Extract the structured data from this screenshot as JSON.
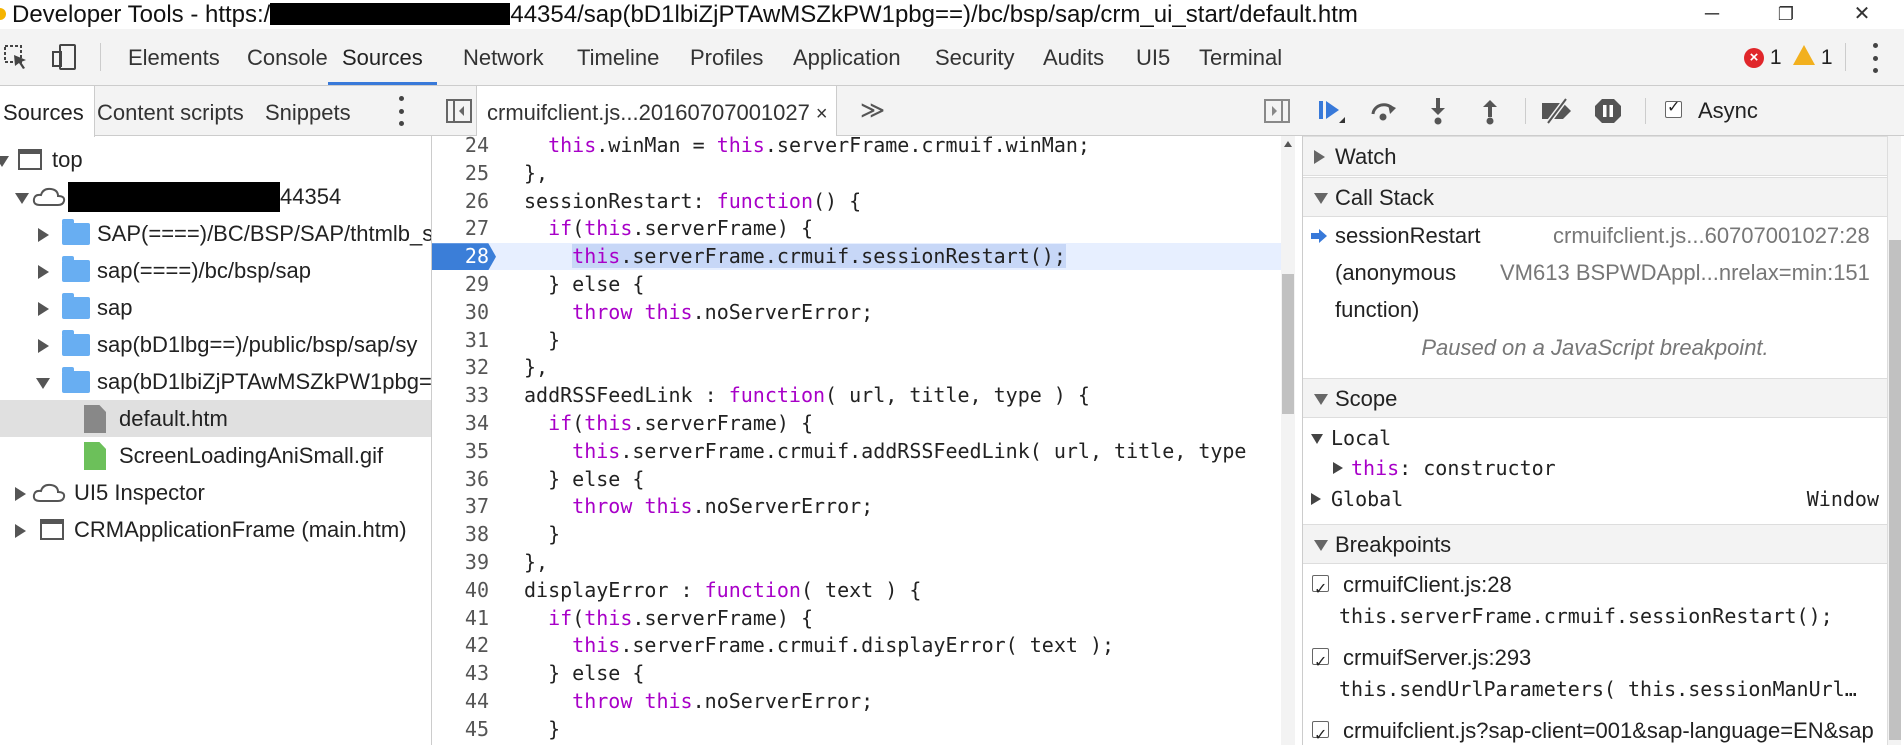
{
  "window": {
    "title_prefix": "Developer Tools - https:/",
    "title_suffix": "44354/sap(bD1lbiZjPTAwMSZkPW1pbg==)/bc/bsp/sap/crm_ui_start/default.htm",
    "minimize": "─",
    "maximize": "❐",
    "close": "✕"
  },
  "main_tabs": [
    "Elements",
    "Console",
    "Sources",
    "Network",
    "Timeline",
    "Profiles",
    "Application",
    "Security",
    "Audits",
    "UI5",
    "Terminal"
  ],
  "active_main_tab": "Sources",
  "counters": {
    "errors": "1",
    "warnings": "1"
  },
  "navigator": {
    "tabs": [
      "Sources",
      "Content scripts",
      "Snippets"
    ],
    "tree": [
      {
        "label": "top"
      },
      {
        "label": "44354"
      },
      {
        "label": "SAP(====)/BC/BSP/SAP/thtmlb_s"
      },
      {
        "label": "sap(====)/bc/bsp/sap"
      },
      {
        "label": "sap"
      },
      {
        "label": "sap(bD1lbg==)/public/bsp/sap/sy"
      },
      {
        "label": "sap(bD1lbiZjPTAwMSZkPW1pbg="
      },
      {
        "label": "default.htm"
      },
      {
        "label": "ScreenLoadingAniSmall.gif"
      },
      {
        "label": "UI5 Inspector"
      },
      {
        "label": "CRMApplicationFrame (main.htm)"
      }
    ]
  },
  "editor": {
    "file_tab": "crmuifclient.js...20160707001027",
    "close_glyph": "×",
    "more_glyph": "≫",
    "breakpoint_line": "28",
    "lines": [
      {
        "n": "24",
        "code": "  this.winMan = this.serverFrame.crmuif.winMan;"
      },
      {
        "n": "25",
        "code": "},"
      },
      {
        "n": "26",
        "code": "sessionRestart: function() {"
      },
      {
        "n": "27",
        "code": "  if(this.serverFrame) {"
      },
      {
        "n": "28",
        "code": "    this.serverFrame.crmuif.sessionRestart();"
      },
      {
        "n": "29",
        "code": "  } else {"
      },
      {
        "n": "30",
        "code": "    throw this.noServerError;"
      },
      {
        "n": "31",
        "code": "  }"
      },
      {
        "n": "32",
        "code": "},"
      },
      {
        "n": "33",
        "code": "addRSSFeedLink : function( url, title, type ) {"
      },
      {
        "n": "34",
        "code": "  if(this.serverFrame) {"
      },
      {
        "n": "35",
        "code": "    this.serverFrame.crmuif.addRSSFeedLink( url, title, type"
      },
      {
        "n": "36",
        "code": "  } else {"
      },
      {
        "n": "37",
        "code": "    throw this.noServerError;"
      },
      {
        "n": "38",
        "code": "  }"
      },
      {
        "n": "39",
        "code": "},"
      },
      {
        "n": "40",
        "code": "displayError : function( text ) {"
      },
      {
        "n": "41",
        "code": "  if(this.serverFrame) {"
      },
      {
        "n": "42",
        "code": "    this.serverFrame.crmuif.displayError( text );"
      },
      {
        "n": "43",
        "code": "  } else {"
      },
      {
        "n": "44",
        "code": "    throw this.noServerError;"
      },
      {
        "n": "45",
        "code": "  }"
      },
      {
        "n": "46",
        "code": "},"
      }
    ]
  },
  "debugger": {
    "async_label": "Async",
    "sections": {
      "watch": "Watch",
      "call_stack": "Call Stack",
      "scope": "Scope",
      "breakpoints": "Breakpoints"
    },
    "call_stack": [
      {
        "fn": "sessionRestart",
        "loc": "crmuifclient.js...60707001027:28"
      },
      {
        "fn": "(anonymous",
        "fn2": "function)",
        "loc": "VM613 BSPWDAppl...nrelax=min:151"
      }
    ],
    "paused_message": "Paused on a JavaScript breakpoint.",
    "scope": {
      "local_label": "Local",
      "this_key": "this",
      "this_value": ": constructor",
      "global_label": "Global",
      "global_value": "Window"
    },
    "breakpoints": [
      {
        "file": "crmuifClient.js:28",
        "code": "this.serverFrame.crmuif.sessionRestart();"
      },
      {
        "file": "crmuifServer.js:293",
        "code": "this.sendUrlParameters( this.sessionManUrl…"
      },
      {
        "file": "crmuifclient.js?sap-client=001&sap-language=EN&sap"
      }
    ]
  },
  "colors": {
    "accent": "#3879d9",
    "keyword": "#a800c8",
    "breakpoint": "#3b7ed8",
    "folder": "#68aef2",
    "error": "#e0262a",
    "warning": "#f2b01e"
  }
}
